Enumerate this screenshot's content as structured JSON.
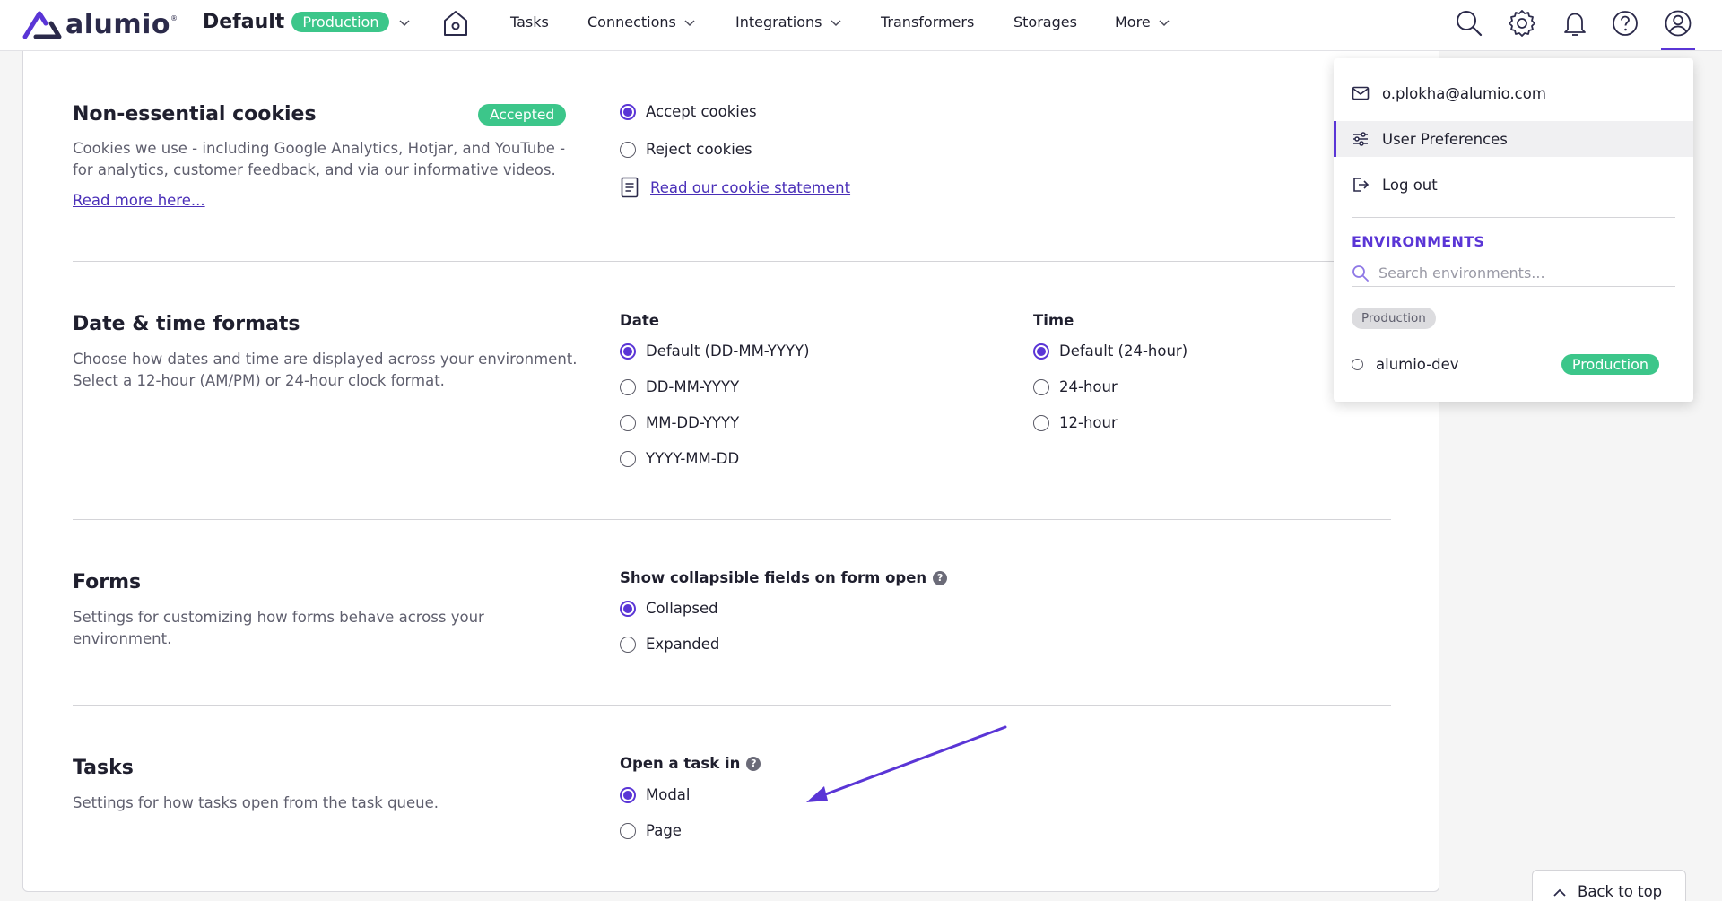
{
  "nav": {
    "logo_text": "alumio",
    "logo_reg": "®",
    "environment_name": "Default",
    "environment_badge": "Production",
    "items": {
      "tasks": "Tasks",
      "connections": "Connections",
      "integrations": "Integrations",
      "transformers": "Transformers",
      "storages": "Storages",
      "more": "More"
    }
  },
  "sections": {
    "cookies": {
      "title": "Non-essential cookies",
      "badge": "Accepted",
      "description_line1": "Cookies we use - including Google Analytics, Hotjar, and YouTube -",
      "description_line2": "for analytics, customer feedback, and via our informative videos.",
      "read_more": "Read more here...",
      "options": [
        "Accept cookies",
        "Reject cookies"
      ],
      "selected": "Accept cookies",
      "statement_link": "Read our cookie statement"
    },
    "datetime": {
      "title": "Date & time formats",
      "description_line1": "Choose how dates and time are displayed across your environment.",
      "description_line2": "Select a 12-hour (AM/PM) or 24-hour clock format.",
      "date_label": "Date",
      "date_options": [
        "Default (DD-MM-YYYY)",
        "DD-MM-YYYY",
        "MM-DD-YYYY",
        "YYYY-MM-DD"
      ],
      "date_selected": "Default (DD-MM-YYYY)",
      "time_label": "Time",
      "time_options": [
        "Default (24-hour)",
        "24-hour",
        "12-hour"
      ],
      "time_selected": "Default (24-hour)"
    },
    "forms": {
      "title": "Forms",
      "description_line1": "Settings for customizing how forms behave across your",
      "description_line2": "environment.",
      "group_label": "Show collapsible fields on form open",
      "options": [
        "Collapsed",
        "Expanded"
      ],
      "selected": "Collapsed"
    },
    "tasks": {
      "title": "Tasks",
      "description": "Settings for how tasks open from the task queue.",
      "group_label": "Open a task in",
      "options": [
        "Modal",
        "Page"
      ],
      "selected": "Modal"
    }
  },
  "help_glyph": "?",
  "user_menu": {
    "email": "o.plokha@alumio.com",
    "preferences": "User Preferences",
    "logout": "Log out",
    "environments_heading": "ENVIRONMENTS",
    "search_placeholder": "Search environments...",
    "group_chip": "Production",
    "environment_entry": "alumio-dev",
    "environment_entry_badge": "Production"
  },
  "back_to_top": "Back to top",
  "colors": {
    "accent": "#5a35d6",
    "success": "#3cc68a",
    "link": "#4a2fb8"
  }
}
